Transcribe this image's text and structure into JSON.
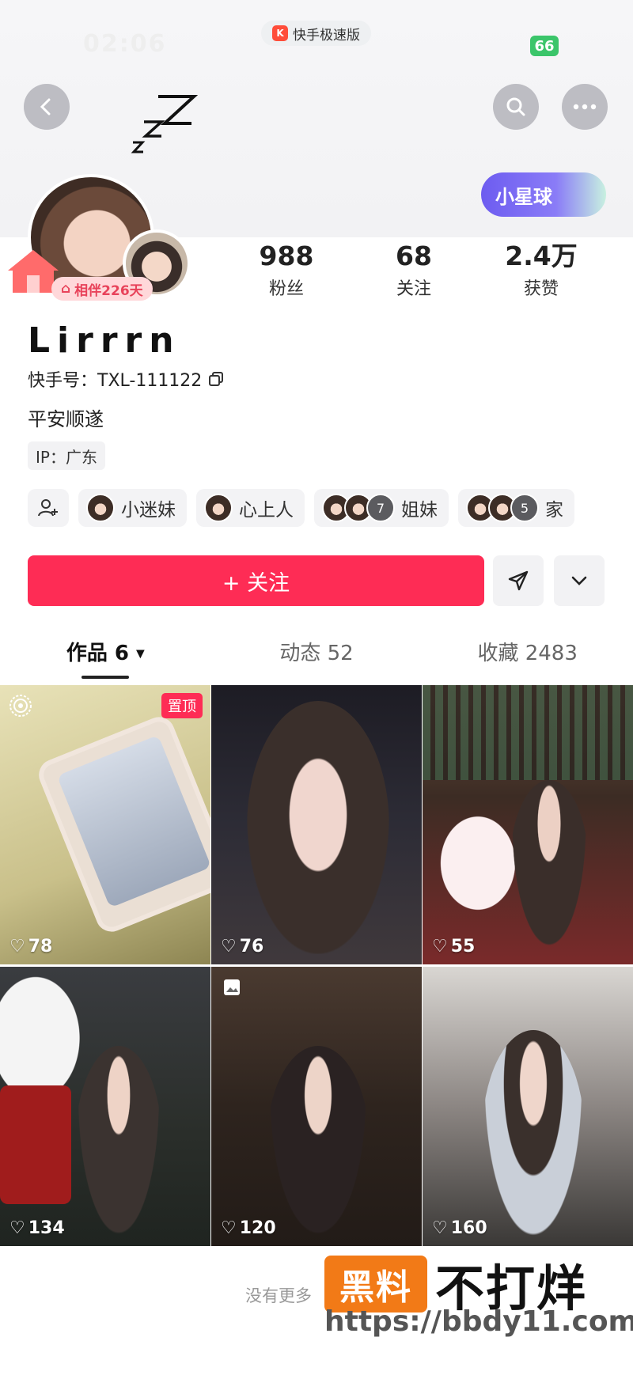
{
  "status": {
    "time": "02:06",
    "battery": "66"
  },
  "app_pill": {
    "label": "快手极速版"
  },
  "planet_badge": {
    "label": "小星球"
  },
  "profile": {
    "companion": "相伴226天",
    "name": "Lirrrn",
    "uid": "快手号：TXL-111122",
    "bio": "平安顺遂",
    "ip": "IP：广东"
  },
  "stats": [
    {
      "value": "988",
      "label": "粉丝"
    },
    {
      "value": "68",
      "label": "关注"
    },
    {
      "value": "2.4万",
      "label": "获赞"
    }
  ],
  "relations": [
    {
      "label": "小迷妹",
      "count": ""
    },
    {
      "label": "心上人",
      "count": ""
    },
    {
      "label": "姐妹",
      "count": "7"
    },
    {
      "label": "家",
      "count": "5"
    }
  ],
  "actions": {
    "follow_label": "+ 关注"
  },
  "tabs": [
    {
      "label": "作品 6"
    },
    {
      "label": "动态 52"
    },
    {
      "label": "收藏 2483"
    }
  ],
  "posts": [
    {
      "likes": "78",
      "pinned": "置顶"
    },
    {
      "likes": "76"
    },
    {
      "likes": "55"
    },
    {
      "likes": "134"
    },
    {
      "likes": "120"
    },
    {
      "likes": "160"
    }
  ],
  "footer": {
    "text": "没有更多"
  },
  "watermark": {
    "box": "黑料",
    "text": "不打烊",
    "url": "https://bbdy11.com"
  }
}
